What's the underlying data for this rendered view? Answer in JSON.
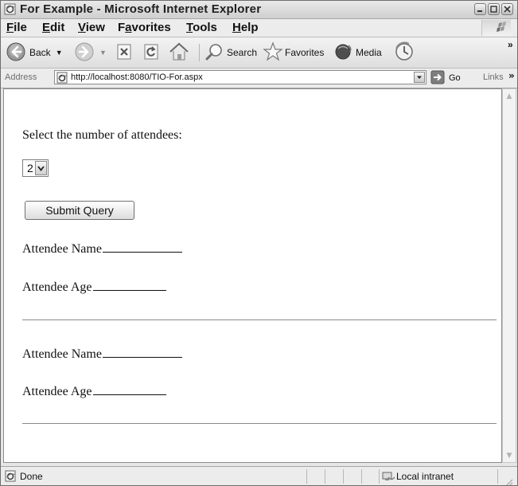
{
  "window": {
    "title": "For Example - Microsoft Internet Explorer"
  },
  "menubar": {
    "items": [
      {
        "mnemonic": "F",
        "rest": "ile"
      },
      {
        "mnemonic": "E",
        "rest": "dit"
      },
      {
        "mnemonic": "V",
        "rest": "iew"
      },
      {
        "pre": "F",
        "mnemonic": "a",
        "rest": "vorites"
      },
      {
        "mnemonic": "T",
        "rest": "ools"
      },
      {
        "mnemonic": "H",
        "rest": "elp"
      }
    ]
  },
  "toolbar": {
    "back_label": "Back",
    "search_label": "Search",
    "favorites_label": "Favorites",
    "media_label": "Media",
    "overflow": "»"
  },
  "addressbar": {
    "label": "Address",
    "url": "http://localhost:8080/TIO-For.aspx",
    "go_label": "Go",
    "links_label": "Links",
    "links_overflow": "»"
  },
  "page": {
    "prompt": "Select the number of attendees:",
    "select_value": "2",
    "submit_label": "Submit Query",
    "attendees": [
      {
        "name_label": "Attendee Name",
        "age_label": "Attendee Age"
      },
      {
        "name_label": "Attendee Name",
        "age_label": "Attendee Age"
      }
    ]
  },
  "statusbar": {
    "status": "Done",
    "zone": "Local intranet"
  },
  "icons": {
    "back": "back-arrow-icon",
    "forward": "forward-arrow-icon",
    "stop": "stop-icon",
    "refresh": "refresh-icon",
    "home": "home-icon",
    "search": "magnifier-icon",
    "favorites": "star-icon",
    "media": "media-icon",
    "history": "history-icon",
    "page": "ie-page-icon",
    "go": "go-arrow-icon",
    "zone": "intranet-icon"
  }
}
